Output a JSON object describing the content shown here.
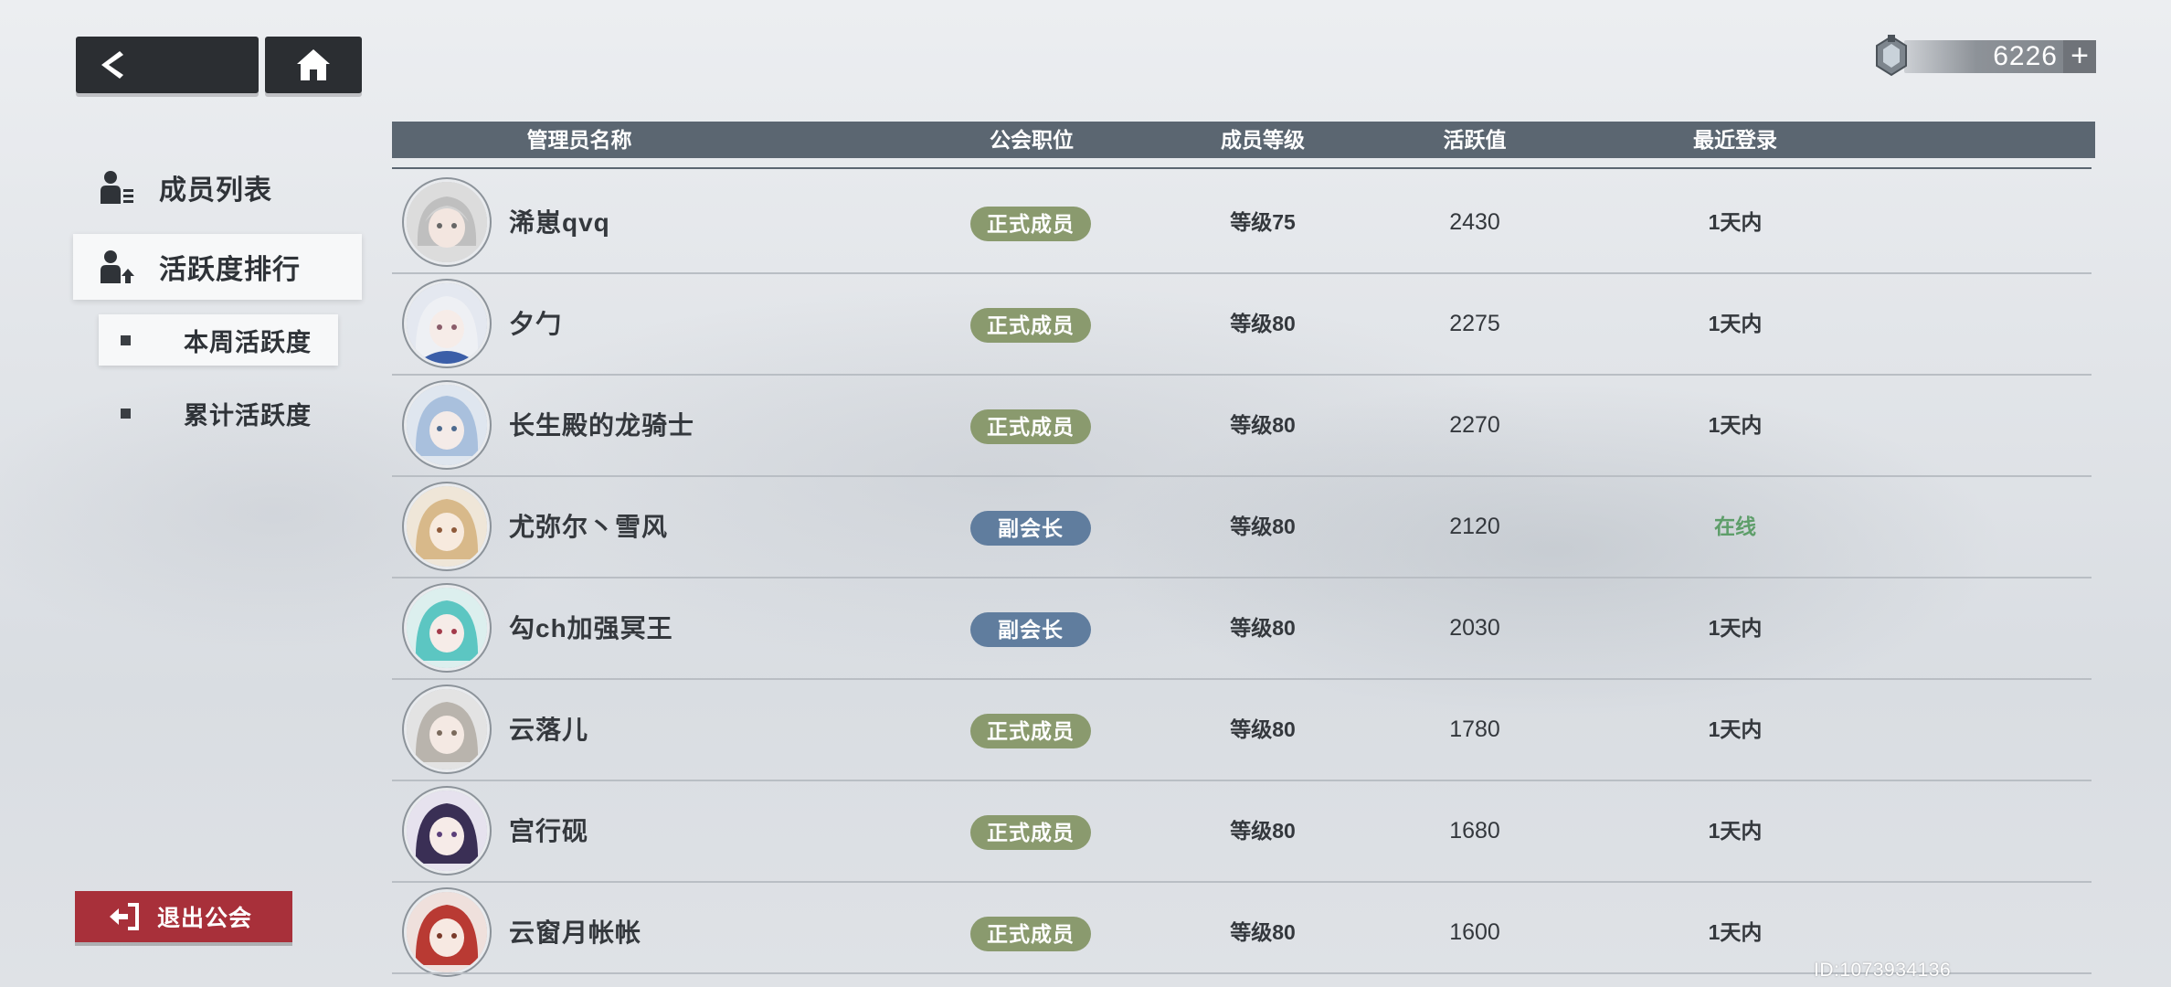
{
  "header": {
    "currency_value": "6226",
    "currency_plus": "+"
  },
  "sidebar": {
    "items": [
      {
        "label": "成员列表",
        "icon": "member-list-icon"
      },
      {
        "label": "活跃度排行",
        "icon": "activity-rank-icon"
      }
    ],
    "subitems": [
      {
        "label": "本周活跃度"
      },
      {
        "label": "累计活跃度"
      }
    ],
    "leave_label": "退出公会"
  },
  "table": {
    "headers": {
      "name": "管理员名称",
      "role": "公会职位",
      "level": "成员等级",
      "activity": "活跃值",
      "login": "最近登录"
    },
    "rows": [
      {
        "name": "浠崽qvq",
        "role": "正式成员",
        "level": "等级75",
        "activity": "2430",
        "login": "1天内"
      },
      {
        "name": "夕勹",
        "role": "正式成员",
        "level": "等级80",
        "activity": "2275",
        "login": "1天内"
      },
      {
        "name": "长生殿的龙骑士",
        "role": "正式成员",
        "level": "等级80",
        "activity": "2270",
        "login": "1天内"
      },
      {
        "name": "尤弥尔丶雪风",
        "role": "副会长",
        "level": "等级80",
        "activity": "2120",
        "login": "在线"
      },
      {
        "name": "勾ch加强冥王",
        "role": "副会长",
        "level": "等级80",
        "activity": "2030",
        "login": "1天内"
      },
      {
        "name": "云落儿",
        "role": "正式成员",
        "level": "等级80",
        "activity": "1780",
        "login": "1天内"
      },
      {
        "name": "宫行砚",
        "role": "正式成员",
        "level": "等级80",
        "activity": "1680",
        "login": "1天内"
      },
      {
        "name": "云窗月帐帐",
        "role": "正式成员",
        "level": "等级80",
        "activity": "1600",
        "login": "1天内"
      }
    ]
  },
  "footer": {
    "uid": "ID:1073934136"
  },
  "colors": {
    "member_badge": "#8a9a6e",
    "vice_badge": "#607d9e",
    "online_text": "#5e9e6a",
    "leave_button": "#a8303a",
    "table_header": "#5b6671"
  }
}
